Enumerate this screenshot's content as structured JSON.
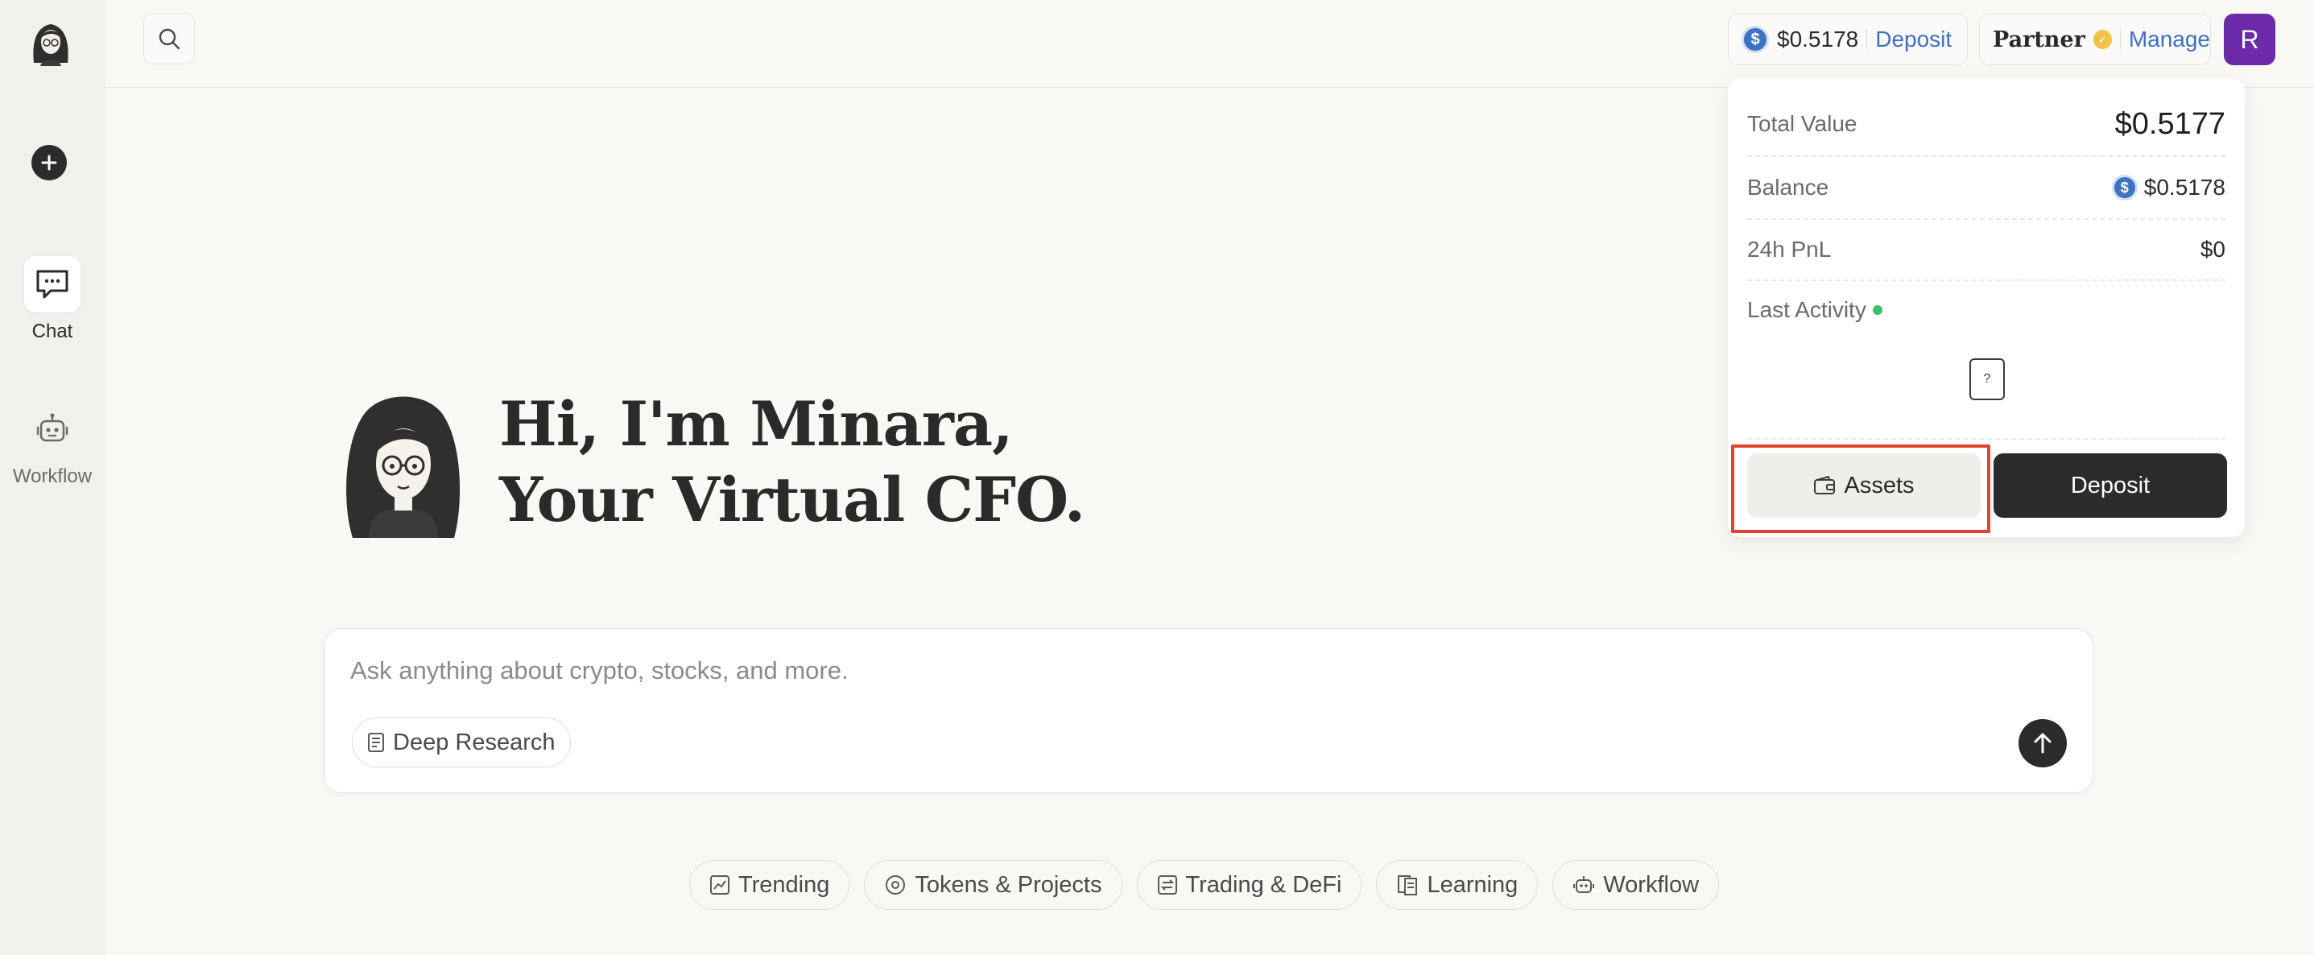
{
  "sidebar": {
    "items": [
      {
        "label": "Chat",
        "icon": "chat-icon",
        "active": true
      },
      {
        "label": "Workflow",
        "icon": "robot-icon",
        "active": false
      }
    ]
  },
  "header": {
    "balance": {
      "icon": "usdc-coin-icon",
      "amount": "$0.5178",
      "action": "Deposit"
    },
    "partner": {
      "label": "Partner",
      "badge_icon": "verified-badge-icon",
      "action": "Manage"
    },
    "avatar_initial": "R"
  },
  "wallet_dropdown": {
    "total_value": {
      "label": "Total Value",
      "value": "$0.5177"
    },
    "balance": {
      "label": "Balance",
      "value": "$0.5178"
    },
    "pnl": {
      "label": "24h PnL",
      "value": "$0"
    },
    "last_activity": {
      "label": "Last Activity",
      "empty_icon": "clipboard-question-icon",
      "empty_glyph": "?"
    },
    "assets_label": "Assets",
    "deposit_label": "Deposit"
  },
  "hero": {
    "line1": "Hi, I'm Minara,",
    "line2": "Your Virtual CFO."
  },
  "composer": {
    "placeholder": "Ask anything about crypto, stocks, and more.",
    "deep_research_label": "Deep Research"
  },
  "suggestion_chips": [
    {
      "label": "Trending",
      "icon": "chart-icon"
    },
    {
      "label": "Tokens & Projects",
      "icon": "target-icon"
    },
    {
      "label": "Trading & DeFi",
      "icon": "exchange-icon"
    },
    {
      "label": "Learning",
      "icon": "book-icon"
    },
    {
      "label": "Workflow",
      "icon": "robot-icon"
    }
  ],
  "colors": {
    "accent_link": "#3f6fc7",
    "avatar_bg": "#6b2aa8",
    "highlight_border": "#e0442f",
    "dark_button": "#2b2b2b",
    "status_green": "#3bbf6a"
  }
}
